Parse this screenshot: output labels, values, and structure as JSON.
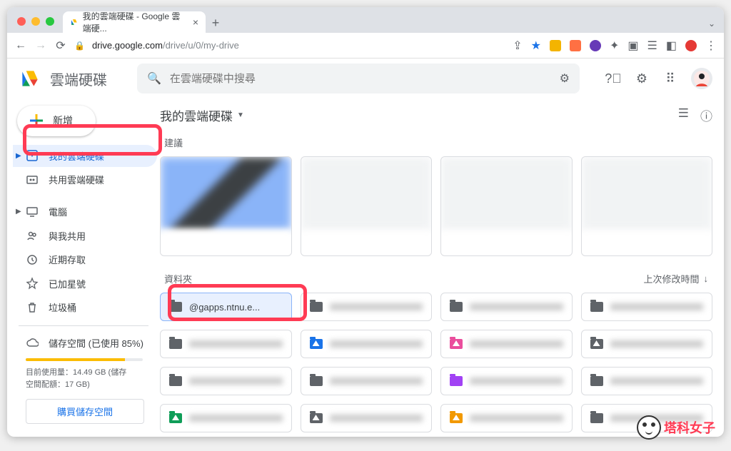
{
  "browser": {
    "tab_title": "我的雲端硬碟 - Google 雲端硬...",
    "url_host": "drive.google.com",
    "url_path": "/drive/u/0/my-drive"
  },
  "header": {
    "product": "雲端硬碟",
    "search_placeholder": "在雲端硬碟中搜尋"
  },
  "sidebar": {
    "new_label": "新增",
    "items": [
      {
        "label": "我的雲端硬碟",
        "active": true,
        "expandable": true
      },
      {
        "label": "共用雲端硬碟",
        "expandable": true
      },
      {
        "label": "電腦",
        "expandable": true,
        "gap": true
      },
      {
        "label": "與我共用"
      },
      {
        "label": "近期存取"
      },
      {
        "label": "已加星號"
      },
      {
        "label": "垃圾桶"
      }
    ],
    "storage_label": "儲存空間 (已使用 85%)",
    "storage_percent": 85,
    "storage_detail1": "目前使用量：14.49 GB (儲存",
    "storage_detail2": "空間配額：17 GB)",
    "buy_label": "購買儲存空間"
  },
  "main": {
    "breadcrumb": "我的雲端硬碟",
    "suggested_label": "建議",
    "folders_label": "資料夾",
    "sort_label": "上次修改時間",
    "highlighted_folder_suffix": "@gapps.ntnu.e...",
    "folders": [
      {
        "color": "#5f6368",
        "selected": true,
        "text": "@gapps.ntnu.e..."
      },
      {
        "color": "#5f6368"
      },
      {
        "color": "#5f6368"
      },
      {
        "color": "#5f6368"
      },
      {
        "color": "#5f6368"
      },
      {
        "color": "#1a73e8",
        "shared": true
      },
      {
        "color": "#ea4e9d",
        "shared": true
      },
      {
        "color": "#5f6368",
        "shared": true
      },
      {
        "color": "#5f6368"
      },
      {
        "color": "#5f6368"
      },
      {
        "color": "#a142f4"
      },
      {
        "color": "#5f6368"
      },
      {
        "color": "#0f9d58",
        "shared": true
      },
      {
        "color": "#5f6368",
        "shared": true
      },
      {
        "color": "#f29900",
        "shared": true
      },
      {
        "color": "#5f6368"
      }
    ]
  },
  "watermark": "塔科女子"
}
